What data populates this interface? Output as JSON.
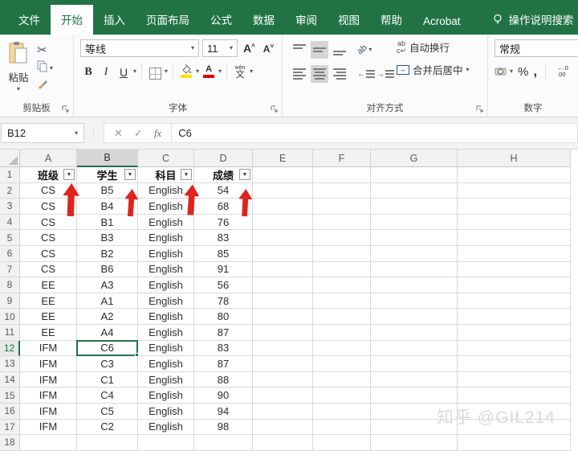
{
  "colors": {
    "excel_green": "#217346",
    "selection_green": "#217346",
    "arrow_red": "#e0231c",
    "fill_yellow": "#ffe400",
    "font_color_red": "#e00000"
  },
  "ribbon": {
    "tabs": [
      {
        "label": "文件",
        "active": false
      },
      {
        "label": "开始",
        "active": true
      },
      {
        "label": "插入",
        "active": false
      },
      {
        "label": "页面布局",
        "active": false
      },
      {
        "label": "公式",
        "active": false
      },
      {
        "label": "数据",
        "active": false
      },
      {
        "label": "审阅",
        "active": false
      },
      {
        "label": "视图",
        "active": false
      },
      {
        "label": "帮助",
        "active": false
      },
      {
        "label": "Acrobat",
        "active": false
      }
    ],
    "search_label": "操作说明搜索",
    "clipboard": {
      "paste_label": "粘贴",
      "group_label": "剪贴板"
    },
    "font": {
      "font_name": "等线",
      "font_size": "11",
      "bold": "B",
      "italic": "I",
      "underline": "U",
      "phonetic_top": "wén",
      "phonetic_char": "文",
      "grow_font": "A",
      "shrink_font": "A",
      "group_label": "字体"
    },
    "alignment": {
      "wrap_label": "自动换行",
      "wrap_icon_text": "ab",
      "merge_label": "合并后居中",
      "orientation_text": "ab",
      "group_label": "对齐方式"
    },
    "number": {
      "format_value": "常规",
      "percent": "%",
      "comma": ",",
      "decimal_top": "←.0",
      "decimal_bottom": ".00",
      "group_label": "数字"
    }
  },
  "formula_bar": {
    "name_box_value": "B12",
    "cancel_glyph": "✕",
    "enter_glyph": "✓",
    "fx_glyph": "fx",
    "formula_value": "C6"
  },
  "grid": {
    "column_letters": [
      "A",
      "B",
      "C",
      "D",
      "E",
      "F",
      "G",
      "H"
    ],
    "row_numbers": [
      1,
      2,
      3,
      4,
      5,
      6,
      7,
      8,
      9,
      10,
      11,
      12,
      13,
      14,
      15,
      16,
      17,
      18
    ],
    "selected_cell": {
      "ref": "B12",
      "column": "B",
      "row": 12,
      "value": "C6"
    },
    "table_headers": [
      "班级",
      "学生",
      "科目",
      "成绩"
    ],
    "filter_glyph": "▼",
    "rows": [
      [
        "CS",
        "B5",
        "English",
        "54"
      ],
      [
        "CS",
        "B4",
        "English",
        "68"
      ],
      [
        "CS",
        "B1",
        "English",
        "76"
      ],
      [
        "CS",
        "B3",
        "English",
        "83"
      ],
      [
        "CS",
        "B2",
        "English",
        "85"
      ],
      [
        "CS",
        "B6",
        "English",
        "91"
      ],
      [
        "EE",
        "A3",
        "English",
        "56"
      ],
      [
        "EE",
        "A1",
        "English",
        "78"
      ],
      [
        "EE",
        "A2",
        "English",
        "80"
      ],
      [
        "EE",
        "A4",
        "English",
        "87"
      ],
      [
        "IFM",
        "C6",
        "English",
        "83"
      ],
      [
        "IFM",
        "C3",
        "English",
        "87"
      ],
      [
        "IFM",
        "C1",
        "English",
        "88"
      ],
      [
        "IFM",
        "C4",
        "English",
        "90"
      ],
      [
        "IFM",
        "C5",
        "English",
        "94"
      ],
      [
        "IFM",
        "C2",
        "English",
        "98"
      ]
    ]
  },
  "annotations": {
    "red_arrow_count": 4
  },
  "watermark": "知乎 @GIL214"
}
